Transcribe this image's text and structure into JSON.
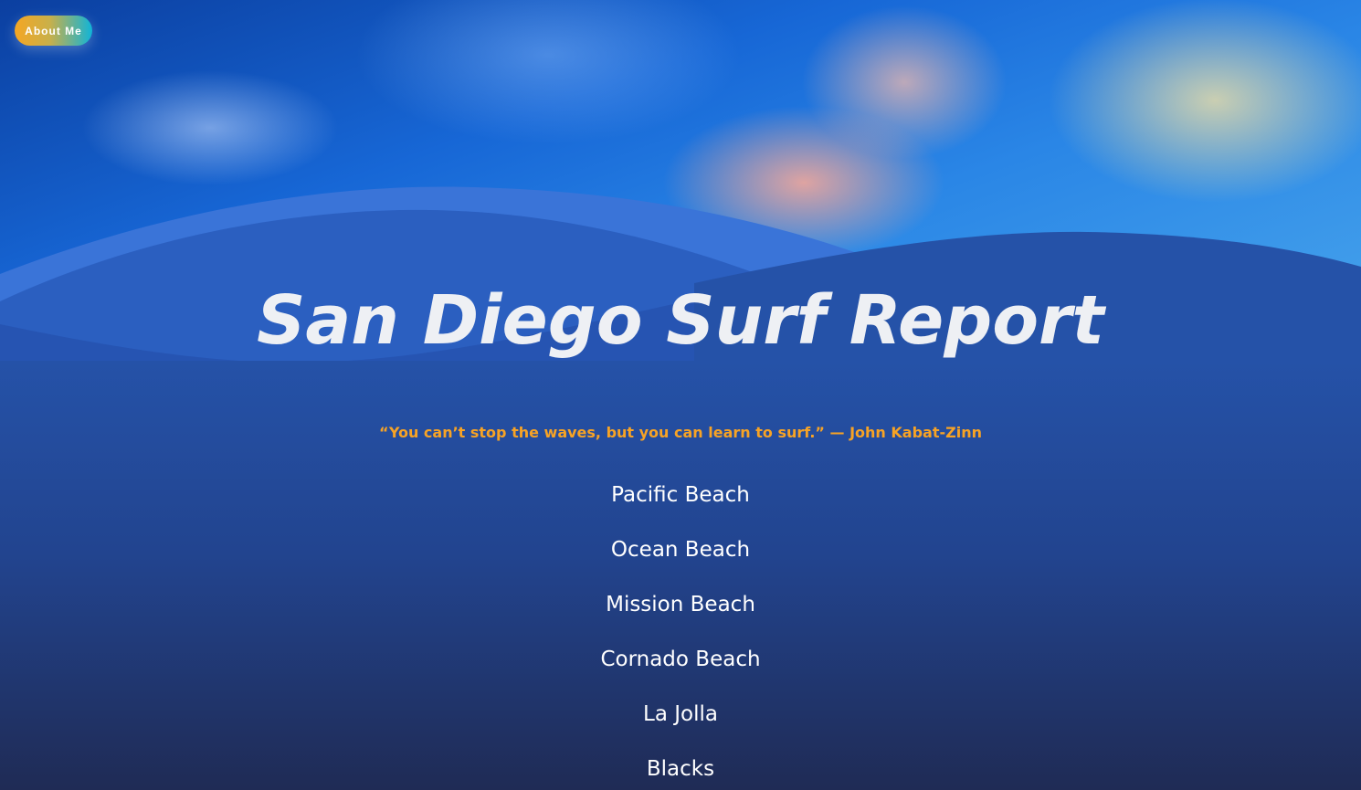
{
  "nav": {
    "about_label": "About Me"
  },
  "hero": {
    "title": "San Diego Surf Report",
    "quote": "“You can’t stop the waves, but you can learn to surf.” — John Kabat-Zinn"
  },
  "beaches": [
    {
      "label": "Pacific Beach"
    },
    {
      "label": "Ocean Beach"
    },
    {
      "label": "Mission Beach"
    },
    {
      "label": "Cornado Beach"
    },
    {
      "label": "La Jolla"
    },
    {
      "label": "Blacks"
    }
  ],
  "colors": {
    "title": "#eef0f4",
    "quote_accent": "#f7a325",
    "button_gradient_start": "#f5a623",
    "button_gradient_end": "#10b4d8",
    "wave_light": "#3a74d8",
    "wave_mid": "#2b5fc0",
    "wave_dark": "#2552a8"
  }
}
